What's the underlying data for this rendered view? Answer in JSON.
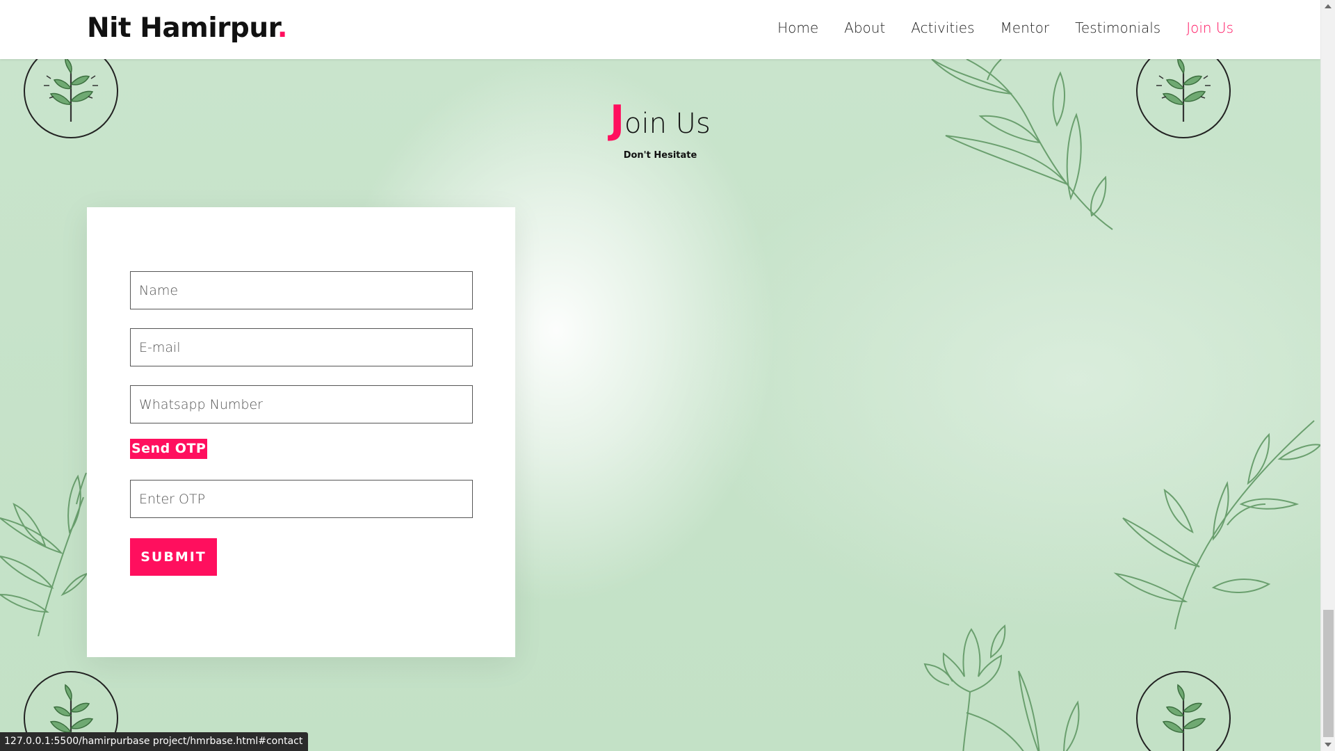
{
  "navbar": {
    "brand": "Nit Hamirpur",
    "brand_dot": ".",
    "links": [
      "Home",
      "About",
      "Activities",
      "Mentor",
      "Testimonials",
      "Join Us"
    ],
    "active_link": "Join Us"
  },
  "section": {
    "title_initial": "J",
    "title_rest": "oin Us",
    "subtitle": "Don't Hesitate"
  },
  "form": {
    "name_placeholder": "Name",
    "email_placeholder": "E-mail",
    "whatsapp_placeholder": "Whatsapp Number",
    "send_otp_label": "Send OTP",
    "otp_placeholder": "Enter OTP",
    "submit_label": "SUBMIT"
  },
  "statusbar": {
    "url": "127.0.0.1:5500/hamirpurbase project/hmrbase.html#contact"
  },
  "colors": {
    "accent": "#ff0f5e",
    "section_bg": "#c6e2c9",
    "leaf_stroke": "#6a9f6e",
    "leaf_fill": "#6fa972"
  },
  "icons": [
    "sprout-badge-icon",
    "leaf-branch-icon",
    "tulip-icon",
    "scroll-up-arrow-icon",
    "scroll-down-arrow-icon"
  ]
}
